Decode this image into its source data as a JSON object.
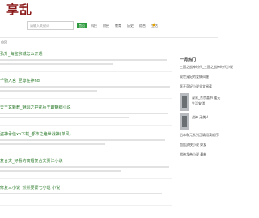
{
  "site": {
    "logo_text": "享乱"
  },
  "search": {
    "placeholder": "请输入关键词"
  },
  "nav": {
    "items": [
      {
        "label": "首页",
        "active": true
      },
      {
        "label": "科技",
        "active": false
      },
      {
        "label": "财经",
        "active": false
      },
      {
        "label": "教育",
        "active": false
      },
      {
        "label": "历史",
        "active": false
      },
      {
        "label": "综合",
        "active": false
      },
      {
        "label": "生活",
        "active": false
      }
    ]
  },
  "toolbar": {
    "icon": "star-icon"
  },
  "section": {
    "title": "首页"
  },
  "articles": [
    {
      "title": "弘升_海宝宗城怎么开通"
    },
    {
      "title": "千骑入宫_至尊狂神hd"
    },
    {
      "title": "天王玄魅教_魅园之护花兵王霸魅卿小说"
    },
    {
      "title": "盗神承佳xh下载_都市之绝世战神(单风)"
    },
    {
      "title": "复合文_好看的离婚复合文贾江小说"
    },
    {
      "title": "修复三小说_然然要蒙七小说 小说"
    }
  ],
  "sidebar": {
    "title": "一周热门",
    "items": [
      {
        "label": "三国之战神时代_三国之战神时代小说"
      },
      {
        "label": "双世宠妃的爱情纠缠"
      },
      {
        "label": "医开孕好小说全文阅读"
      }
    ],
    "thumbs": [
      {
        "cap1": "深米_东京喜书 暖无",
        "cap2": "生活安琪"
      },
      {
        "cap1": "战神 无美人"
      }
    ],
    "more": [
      {
        "label": "后本和元系列正确阅读顺序"
      },
      {
        "label": "血族武侠小说 好友"
      },
      {
        "label": "战神龙帝小说 最新"
      }
    ]
  }
}
